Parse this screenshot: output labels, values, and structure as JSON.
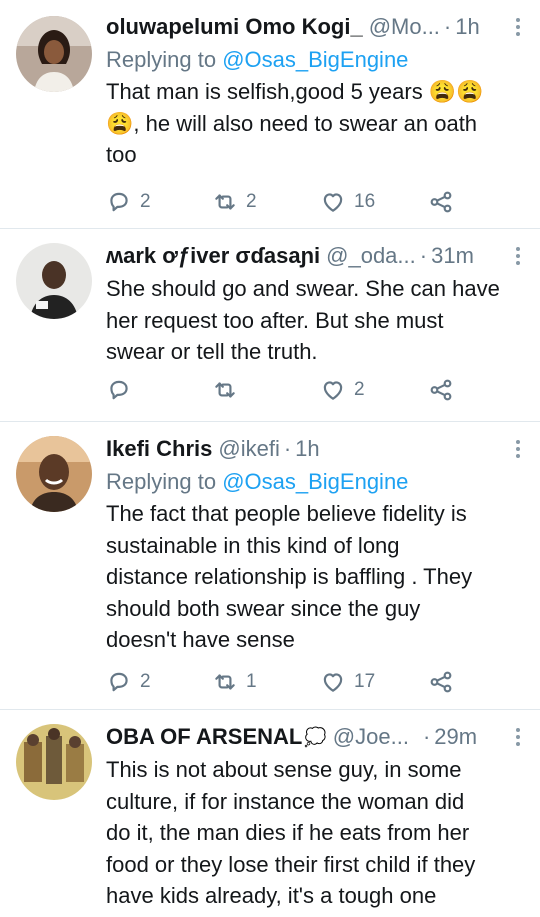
{
  "tweets": [
    {
      "name": "oluwapelumi Omo Kogi_",
      "handle": "@Mo...",
      "sep": "·",
      "time": "1h",
      "replying_prefix": "Replying to",
      "replying_to": "@Osas_BigEngine",
      "lines": [
        "That man is selfish,good 5 years 😩😩",
        "😩, he will also need to swear an oath",
        "too"
      ],
      "replies": "2",
      "retweets": "2",
      "likes": "16"
    },
    {
      "name": "ʍark ơƒiver σɗasaɲi",
      "handle": "@_oda...",
      "sep": "·",
      "time": "31m",
      "lines": [
        "She should go and swear. She can have",
        "her request too after. But she must",
        "swear or tell the truth."
      ],
      "replies": "",
      "retweets": "",
      "likes": "2"
    },
    {
      "name": "Ikefi Chris",
      "handle": "@ikefi",
      "sep": "·",
      "time": "1h",
      "replying_prefix": "Replying to",
      "replying_to": "@Osas_BigEngine",
      "lines": [
        "The fact that people believe fidelity is",
        "sustainable in this kind of long",
        "distance relationship is baffling . They",
        "should both swear since the guy",
        "doesn't have sense"
      ],
      "replies": "2",
      "retweets": "1",
      "likes": "17"
    },
    {
      "name": "OBA OF ARSENAL",
      "name_emoji": "💭",
      "handle": "@Joe...",
      "sep": "·",
      "time": "29m",
      "lines": [
        "This is not about sense guy, in some",
        "culture, if for instance the woman did",
        "do it, the man dies if he eats from her",
        "food or they lose their first child if they",
        "have kids already, it's a tough one"
      ]
    }
  ],
  "colors": {
    "primary_text": "#14171a",
    "secondary_text": "#657786",
    "link": "#1da1f2",
    "divider": "#e1e8ed"
  }
}
